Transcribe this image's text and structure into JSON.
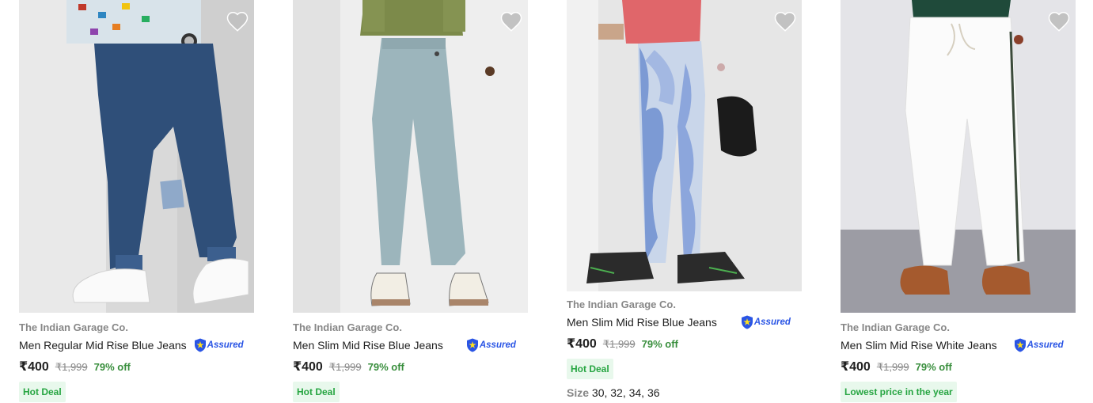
{
  "colors": {
    "brand_text": "#878787",
    "price_green": "#388e3c",
    "deal_bg": "#e8f8ec",
    "deal_text": "#26a541",
    "assured_blue": "#2a55e5",
    "wishlist_grey": "#c2c2c2"
  },
  "products": [
    {
      "brand": "The Indian Garage Co.",
      "title": "Men Regular Mid Rise Blue Jeans",
      "assured": "Assured",
      "price": "₹400",
      "mrp": "₹1,999",
      "discount": "79% off",
      "tag": "Hot Deal",
      "wishlist_icon": "heart-icon"
    },
    {
      "brand": "The Indian Garage Co.",
      "title": "Men Slim Mid Rise Blue Jeans",
      "assured": "Assured",
      "price": "₹400",
      "mrp": "₹1,999",
      "discount": "79% off",
      "tag": "Hot Deal",
      "wishlist_icon": "heart-icon"
    },
    {
      "brand": "The Indian Garage Co.",
      "title": "Men Slim Mid Rise Blue Jeans",
      "assured": "Assured",
      "price": "₹400",
      "mrp": "₹1,999",
      "discount": "79% off",
      "tag": "Hot Deal",
      "size_label": "Size",
      "sizes": "30, 32, 34, 36",
      "wishlist_icon": "heart-icon"
    },
    {
      "brand": "The Indian Garage Co.",
      "title": "Men Slim Mid Rise White Jeans",
      "assured": "Assured",
      "price": "₹400",
      "mrp": "₹1,999",
      "discount": "79% off",
      "tag": "Lowest price in the year",
      "wishlist_icon": "heart-icon"
    }
  ]
}
